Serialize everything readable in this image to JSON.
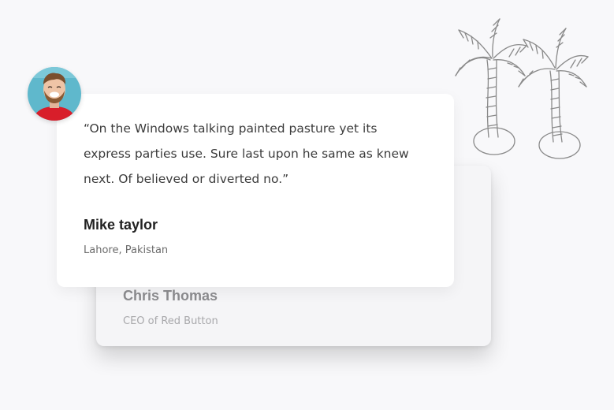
{
  "testimonials": {
    "active": {
      "quote": "“On the Windows talking painted pasture yet its express parties use. Sure last upon he same as knew next. Of believed or diverted no.”",
      "name": "Mike taylor",
      "location": "Lahore, Pakistan",
      "avatar_icon": "person-avatar"
    },
    "next": {
      "name": "Chris Thomas",
      "role": "CEO of Red Button"
    }
  },
  "decoration": {
    "icon": "palm-trees-doodle"
  },
  "colors": {
    "background": "#f8f8fa",
    "card": "#ffffff",
    "avatar_backdrop": "#5fb8cc",
    "avatar_shirt": "#d81e2a"
  }
}
